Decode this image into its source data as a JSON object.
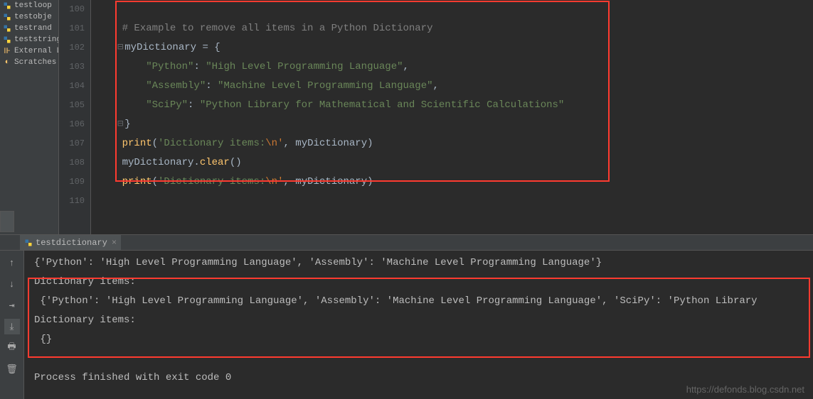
{
  "sidebar": {
    "items": [
      {
        "label": "testloop"
      },
      {
        "label": "testobje"
      },
      {
        "label": "testrand"
      },
      {
        "label": "teststring"
      }
    ],
    "external": "External Lib",
    "scratches": "Scratches a"
  },
  "gutter": {
    "lines": [
      "100",
      "101",
      "102",
      "103",
      "104",
      "105",
      "106",
      "107",
      "108",
      "109",
      "110"
    ]
  },
  "code": {
    "l101": "    # Example to remove all items in a Python Dictionary",
    "l102_ident": "myDictionary",
    "l102_rest": " = {",
    "l103_key": "\"Python\"",
    "l103_sep": ": ",
    "l103_val": "\"High Level Programming Language\"",
    "l104_key": "\"Assembly\"",
    "l104_val": "\"Machine Level Programming Language\"",
    "l105_key": "\"SciPy\"",
    "l105_val": "\"Python Library for Mathematical and Scientific Calculations\"",
    "l106": "}",
    "l107_print": "print",
    "l107_str": "'Dictionary items:",
    "l107_esc": "\\n'",
    "l107_arg": ", myDictionary)",
    "l108_ident": "    myDictionary.",
    "l108_clear": "clear",
    "l108_rest": "()",
    "l109_print": "print",
    "l109_str": "'Dictionary items:",
    "l109_esc": "\\n'",
    "l109_arg": ", myDictionary)"
  },
  "tab": {
    "name": "testdictionary",
    "close": "×"
  },
  "console": {
    "l0": "{'Python': 'High Level Programming Language', 'Assembly': 'Machine Level Programming Language'}",
    "l1": "Dictionary items:",
    "l2": " {'Python': 'High Level Programming Language', 'Assembly': 'Machine Level Programming Language', 'SciPy': 'Python Library",
    "l3": "Dictionary items:",
    "l4": " {}",
    "l5": "",
    "l6": "Process finished with exit code 0"
  },
  "watermark": "https://defonds.blog.csdn.net"
}
